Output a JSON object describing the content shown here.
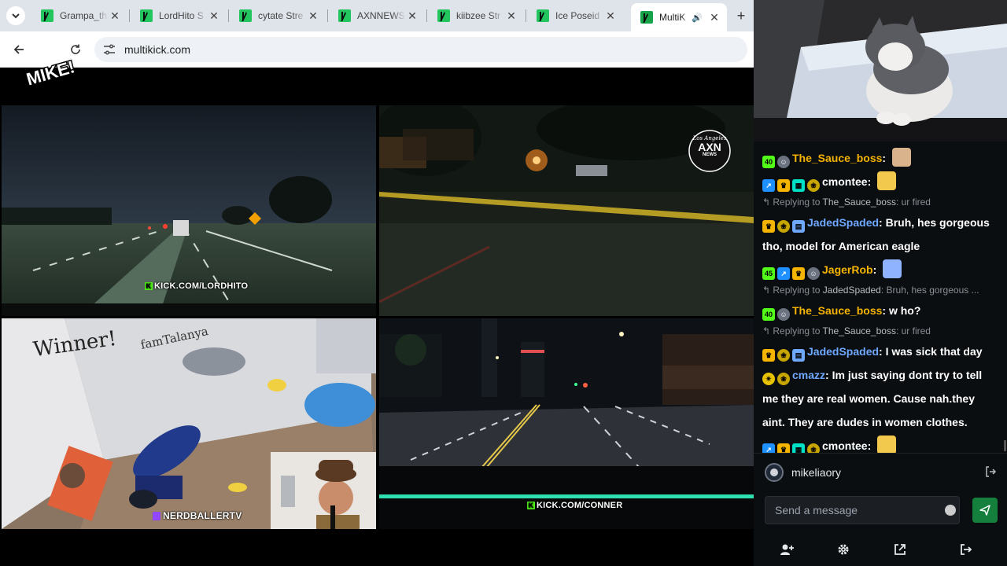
{
  "browser": {
    "tabs": [
      {
        "title": "Grampa_th",
        "active": false
      },
      {
        "title": "LordHito S",
        "active": false
      },
      {
        "title": "cytate Stre",
        "active": false
      },
      {
        "title": "AXNNEWS",
        "active": false
      },
      {
        "title": "kiibzee Str",
        "active": false
      },
      {
        "title": "Ice Poseid",
        "active": false
      },
      {
        "title": "MultiK",
        "active": true
      }
    ],
    "new_tab_label": "+",
    "url": "multikick.com",
    "sticker_text": "MIKE!"
  },
  "streams": [
    {
      "name": "lordhito",
      "watermark": "KICK.COM/LORDHITO"
    },
    {
      "name": "axnnews",
      "logo_text": "AXN",
      "logo_top": "Los Angeles",
      "logo_bottom": "NEWS"
    },
    {
      "name": "nerdballer",
      "watermark": "NERDBALLERTV",
      "graffiti_1": "Winner!",
      "graffiti_2": "famTalanya"
    },
    {
      "name": "conner",
      "watermark": "KICK.COM/CONNER"
    }
  ],
  "chat": {
    "messages": [
      {
        "type": "msg",
        "badges": [
          "sub-40",
          "mod"
        ],
        "user": "The_Sauce_boss",
        "user_color": "#f5b400",
        "text": "",
        "emote": "#d9b38c"
      },
      {
        "type": "msg",
        "badges": [
          "og",
          "crown",
          "vip",
          "gift"
        ],
        "user": "cmontee",
        "user_color": "#ffffff",
        "text": "",
        "emote": "#f2c94c"
      },
      {
        "type": "reply",
        "to": "The_Sauce_boss",
        "text": "ur fired"
      },
      {
        "type": "msg",
        "badges": [
          "crown",
          "gift",
          "tool"
        ],
        "user": "JadedSpaded",
        "user_color": "#6fa8ff",
        "text": "Bruh, hes gorgeous tho, model for American eagle",
        "wrap": true
      },
      {
        "type": "msg",
        "badges": [
          "sub-45",
          "og",
          "crown",
          "mod"
        ],
        "user": "JagerRob",
        "user_color": "#f5b400",
        "text": "",
        "emote": "#8fb3ff"
      },
      {
        "type": "reply",
        "to": "JadedSpaded",
        "text": "Bruh, hes gorgeous ..."
      },
      {
        "type": "msg",
        "badges": [
          "sub-40",
          "mod"
        ],
        "user": "The_Sauce_boss",
        "user_color": "#f5b400",
        "text": "w ho?"
      },
      {
        "type": "reply",
        "to": "The_Sauce_boss",
        "text": "ur fired"
      },
      {
        "type": "msg",
        "badges": [
          "crown",
          "gift",
          "tool"
        ],
        "user": "JadedSpaded",
        "user_color": "#6fa8ff",
        "text": "I was sick that day"
      },
      {
        "type": "msg",
        "badges": [
          "moon",
          "gift"
        ],
        "user": "cmazz",
        "user_color": "#6fa8ff",
        "text": "Im just saying dont try to tell me they are real women. Cause nah.they aint. They are dudes in women clothes.",
        "wrap": true
      },
      {
        "type": "msg",
        "badges": [
          "og",
          "crown",
          "vip",
          "gift"
        ],
        "user": "cmontee",
        "user_color": "#ffffff",
        "text": "",
        "emote": "#f2c94c"
      }
    ],
    "username": "mikeliaory",
    "input_placeholder": "Send a message",
    "sub_badges": {
      "sub-40": "40",
      "sub-45": "45"
    }
  },
  "colors": {
    "kick_green": "#53fc18",
    "send_button": "#15803d",
    "chat_bg": "#0b0e11"
  }
}
